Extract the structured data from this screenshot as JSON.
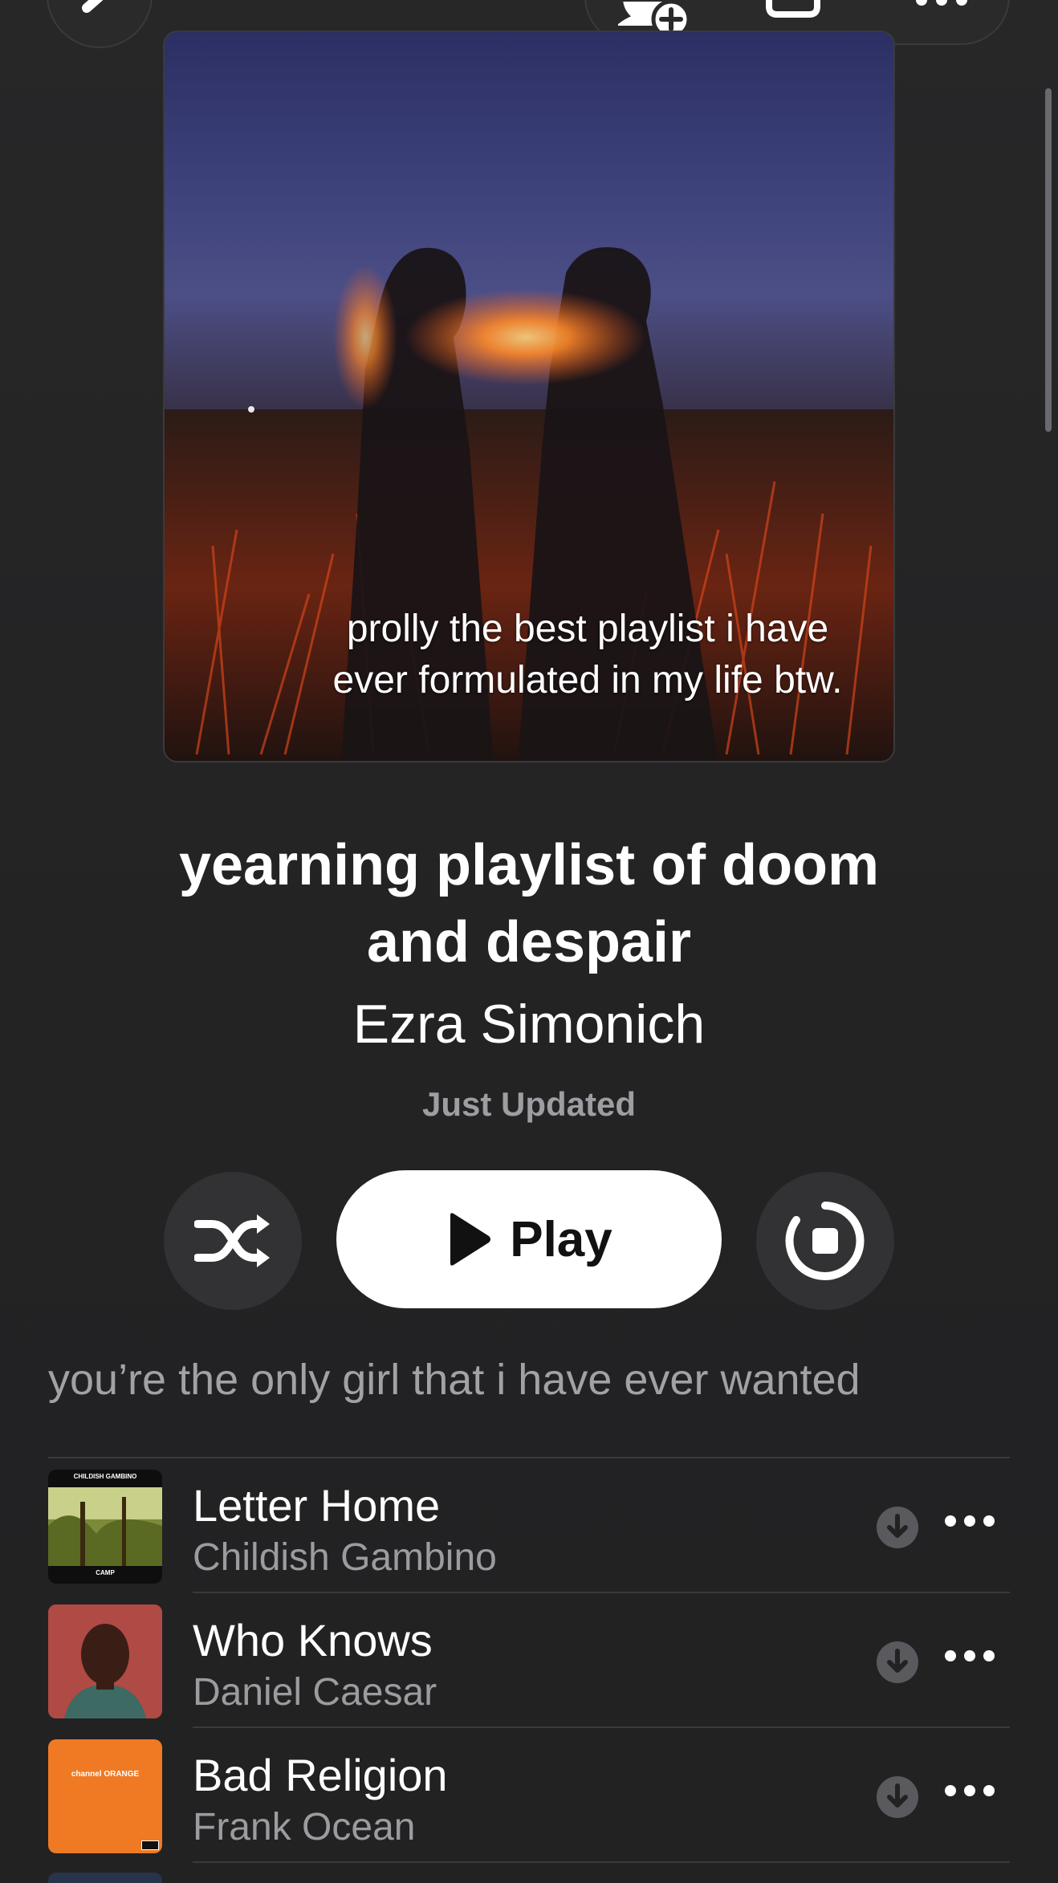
{
  "icons": {
    "back": "chevron-left-icon",
    "add_friend": "add-person-icon",
    "share": "share-square-icon",
    "more": "ellipsis-icon",
    "shuffle": "shuffle-icon",
    "play": "play-triangle-icon",
    "loop": "loop-ring-icon",
    "download": "download-circle-icon",
    "track_more": "ellipsis-icon"
  },
  "artwork": {
    "caption": "prolly the best playlist i have ever formulated in my life btw."
  },
  "playlist": {
    "title": "yearning playlist of doom and despair",
    "curator": "Ezra Simonich",
    "updated": "Just Updated",
    "description": "you’re the only girl that i have ever wanted"
  },
  "controls": {
    "play_label": "Play"
  },
  "tracks": [
    {
      "name": "Letter Home",
      "artist": "Childish Gambino",
      "art_top_text": "CHILDISH GAMBINO",
      "art_bottom_text": "CAMP"
    },
    {
      "name": "Who Knows",
      "artist": "Daniel Caesar"
    },
    {
      "name": "Bad Religion",
      "artist": "Frank Ocean",
      "art_text": "channel ORANGE"
    }
  ],
  "colors": {
    "background": "#222223",
    "secondary_text": "#9b9ba0",
    "button_dark": "#323234",
    "play_button": "#ffffff",
    "orange_art": "#f07a23"
  }
}
